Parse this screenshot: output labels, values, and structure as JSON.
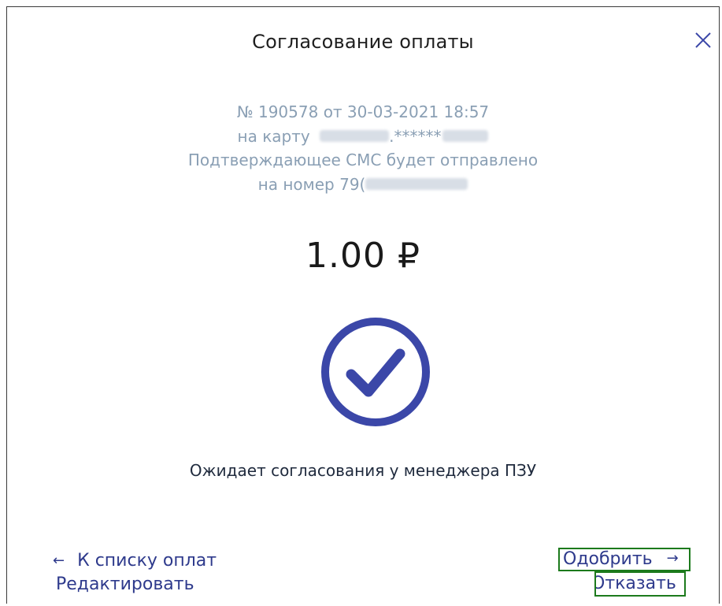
{
  "dialog": {
    "title": "Согласование оплаты",
    "close_icon": "close-icon"
  },
  "payment": {
    "number_line": "№ 190578 от 30-03-2021 18:57",
    "card_prefix": "на карту",
    "card_masked": ".******",
    "sms_line": "Подтверждающее СМС будет отправлено",
    "phone_prefix": "на номер 79("
  },
  "amount": "1.00 ₽",
  "status": {
    "icon": "check-circle-icon",
    "text": "Ожидает согласования у менеджера ПЗУ",
    "color": "#3b47a8"
  },
  "actions": {
    "back_arrow": "←",
    "back_label": "К списку оплат",
    "edit_label": "Редактировать",
    "approve_label": "Одобрить",
    "approve_arrow": "→",
    "reject_label": "Отказать"
  },
  "colors": {
    "link": "#2e3a8c",
    "info_text": "#8a9fb4",
    "highlight": "#1c7a1c"
  }
}
